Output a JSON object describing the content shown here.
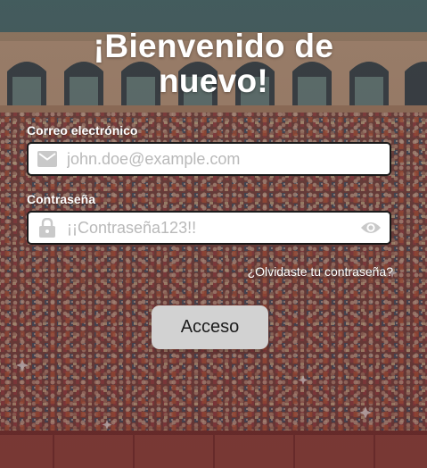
{
  "login": {
    "title_line1": "¡Bienvenido de",
    "title_line2": "nuevo!",
    "email": {
      "label": "Correo electrónico",
      "placeholder": "john.doe@example.com",
      "value": "",
      "icon": "envelope-icon"
    },
    "password": {
      "label": "Contraseña",
      "placeholder": "¡¡Contraseña123!!",
      "value": "",
      "icon": "lock-icon",
      "toggle_icon": "eye-icon"
    },
    "forgot_link": "¿Olvidaste tu contraseña?",
    "submit_label": "Acceso"
  },
  "theme": {
    "field_border": "#1a1a1a",
    "button_bg": "#d2d2d2",
    "text_color": "#ffffff",
    "placeholder_color": "#b9b9b9",
    "icon_color": "#c9c9c9"
  }
}
